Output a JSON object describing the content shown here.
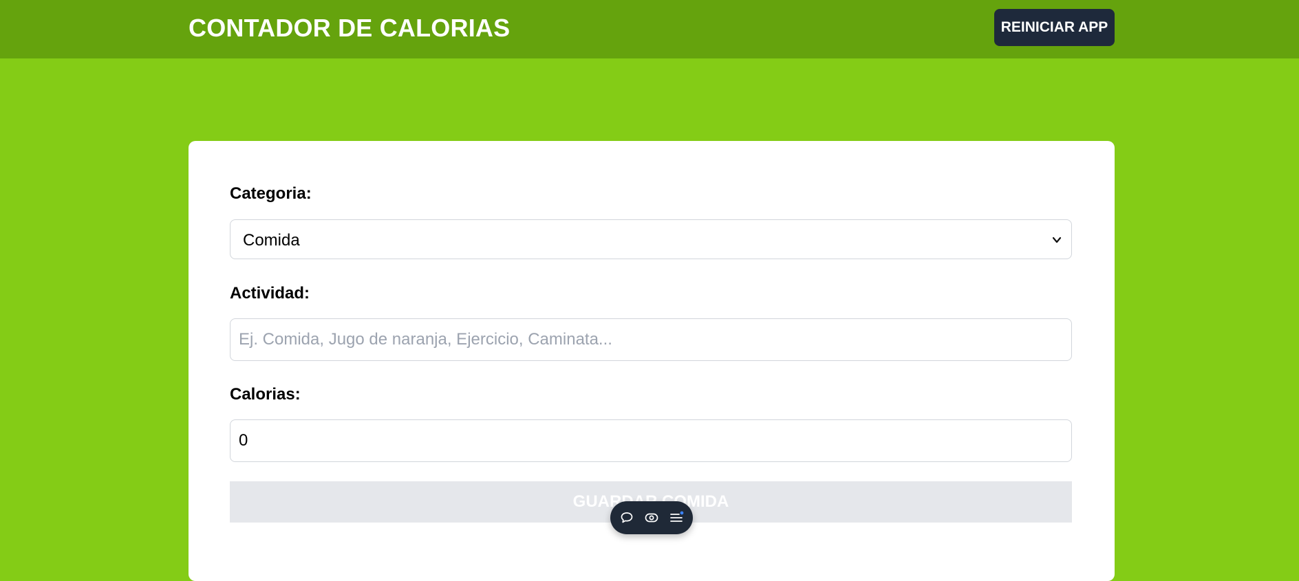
{
  "header": {
    "title": "CONTADOR DE CALORIAS",
    "reset_label": "REINICIAR APP"
  },
  "form": {
    "category_label": "Categoria:",
    "category_value": "Comida",
    "activity_label": "Actividad:",
    "activity_placeholder": "Ej. Comida, Jugo de naranja, Ejercicio, Caminata...",
    "activity_value": "",
    "calories_label": "Calorias:",
    "calories_value": "0",
    "submit_label": "GUARDAR COMIDA"
  },
  "toolbar": {
    "icons": [
      "chat-bubble-icon",
      "eye-icon",
      "menu-list-icon"
    ]
  },
  "colors": {
    "page_background": "#84cc16",
    "header_background": "#65a30d",
    "reset_button": "#1e293b",
    "submit_disabled": "#e5e7eb",
    "toolbar": "#1f2937"
  }
}
